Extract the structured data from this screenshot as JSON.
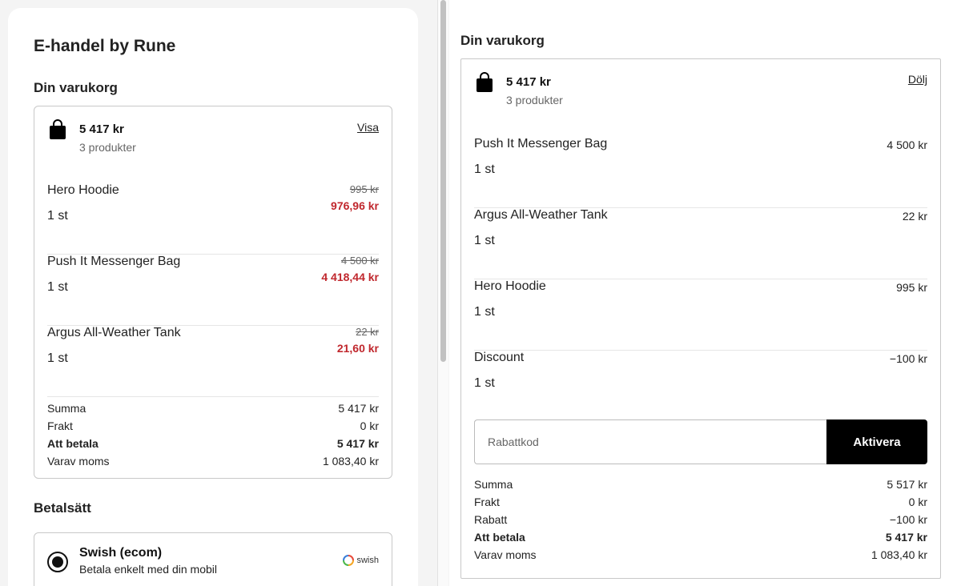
{
  "shop": {
    "title": "E-handel by Rune"
  },
  "left_cart": {
    "title": "Din varukorg",
    "total": "5 417 kr",
    "count": "3 produkter",
    "toggle": "Visa",
    "items": [
      {
        "name": "Hero Hoodie",
        "qty": "1 st",
        "old_price": "995 kr",
        "new_price": "976,96 kr"
      },
      {
        "name": "Push It Messenger Bag",
        "qty": "1 st",
        "old_price": "4 500 kr",
        "new_price": "4 418,44 kr"
      },
      {
        "name": "Argus All-Weather Tank",
        "qty": "1 st",
        "old_price": "22 kr",
        "new_price": "21,60 kr"
      }
    ],
    "summary": [
      {
        "label": "Summa",
        "value": "5 417 kr"
      },
      {
        "label": "Frakt",
        "value": "0 kr"
      },
      {
        "label": "Att betala",
        "value": "5 417 kr"
      },
      {
        "label": "Varav moms",
        "value": "1 083,40 kr"
      }
    ]
  },
  "payment": {
    "title": "Betalsätt",
    "method_name": "Swish (ecom)",
    "method_desc": "Betala enkelt med din mobil",
    "logo_text": "swish"
  },
  "right_cart": {
    "title": "Din varukorg",
    "total": "5 417 kr",
    "count": "3 produkter",
    "toggle": "Dölj",
    "items": [
      {
        "name": "Push It Messenger Bag",
        "qty": "1 st",
        "price": "4 500 kr"
      },
      {
        "name": "Argus All-Weather Tank",
        "qty": "1 st",
        "price": "22 kr"
      },
      {
        "name": "Hero Hoodie",
        "qty": "1 st",
        "price": "995 kr"
      },
      {
        "name": "Discount",
        "qty": "1 st",
        "price": "−100 kr"
      }
    ],
    "discount_placeholder": "Rabattkod",
    "activate_label": "Aktivera",
    "summary": [
      {
        "label": "Summa",
        "value": "5 517 kr"
      },
      {
        "label": "Frakt",
        "value": "0 kr"
      },
      {
        "label": "Rabatt",
        "value": "−100 kr"
      },
      {
        "label": "Att betala",
        "value": "5 417 kr"
      },
      {
        "label": "Varav moms",
        "value": "1 083,40 kr"
      }
    ]
  },
  "colors": {
    "sale_price": "#c0272d",
    "button_bg": "#000000",
    "border": "#c8c8c8"
  },
  "icons": {
    "bag": "shopping-bag-icon",
    "radio": "radio-selected-icon",
    "swish": "swish-logo-icon"
  }
}
